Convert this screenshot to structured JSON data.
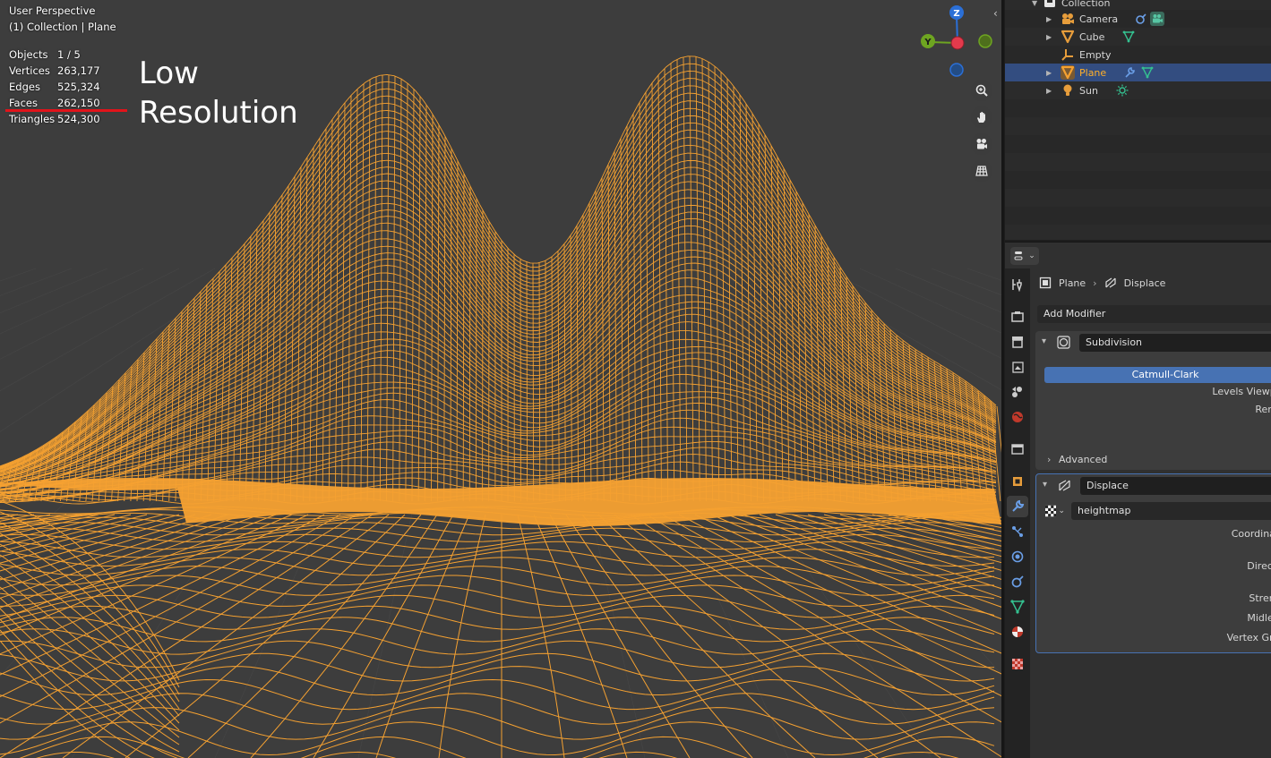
{
  "viewport": {
    "title": "User Perspective",
    "subtitle": "(1) Collection | Plane",
    "stats": [
      {
        "key": "Objects",
        "value": "1 / 5"
      },
      {
        "key": "Vertices",
        "value": "263,177"
      },
      {
        "key": "Edges",
        "value": "525,324"
      },
      {
        "key": "Faces",
        "value": "262,150"
      },
      {
        "key": "Triangles",
        "value": "524,300"
      }
    ],
    "annotation_line1": "Low",
    "annotation_line2": "Resolution",
    "gizmo": {
      "z": "Z",
      "y": "Y"
    },
    "wire_color": "#f5a131",
    "background_color": "#3d3d3d",
    "nav_icons": [
      "zoom-icon",
      "pan-hand-icon",
      "camera-view-icon",
      "grid-ortho-icon"
    ]
  },
  "outliner": {
    "items": [
      {
        "label": "Collection",
        "icon": "collection-icon"
      },
      {
        "label": "Camera",
        "icon": "camera-object-icon"
      },
      {
        "label": "Cube",
        "icon": "mesh-object-icon"
      },
      {
        "label": "Empty",
        "icon": "empty-object-icon"
      },
      {
        "label": "Plane",
        "icon": "mesh-object-icon",
        "selected": true
      },
      {
        "label": "Sun",
        "icon": "light-object-icon"
      }
    ],
    "selection_color": "#334d80"
  },
  "properties": {
    "breadcrumb": {
      "object": "Plane",
      "modifier": "Displace"
    },
    "add_modifier": "Add Modifier",
    "subdivision": {
      "name": "Subdivision",
      "method": "Catmull-Clark",
      "levels_viewport_label": "Levels Viewpor",
      "render_label": "Rende",
      "advanced_label": "Advanced"
    },
    "displace": {
      "name": "Displace",
      "texture": "heightmap",
      "coordinates_label": "Coordinate",
      "direction_label": "Directio",
      "strength_label": "Strengt",
      "midlevel_label": "Midleve",
      "vertex_group_label": "Vertex Grou"
    },
    "accent_color": "#4772b3"
  }
}
